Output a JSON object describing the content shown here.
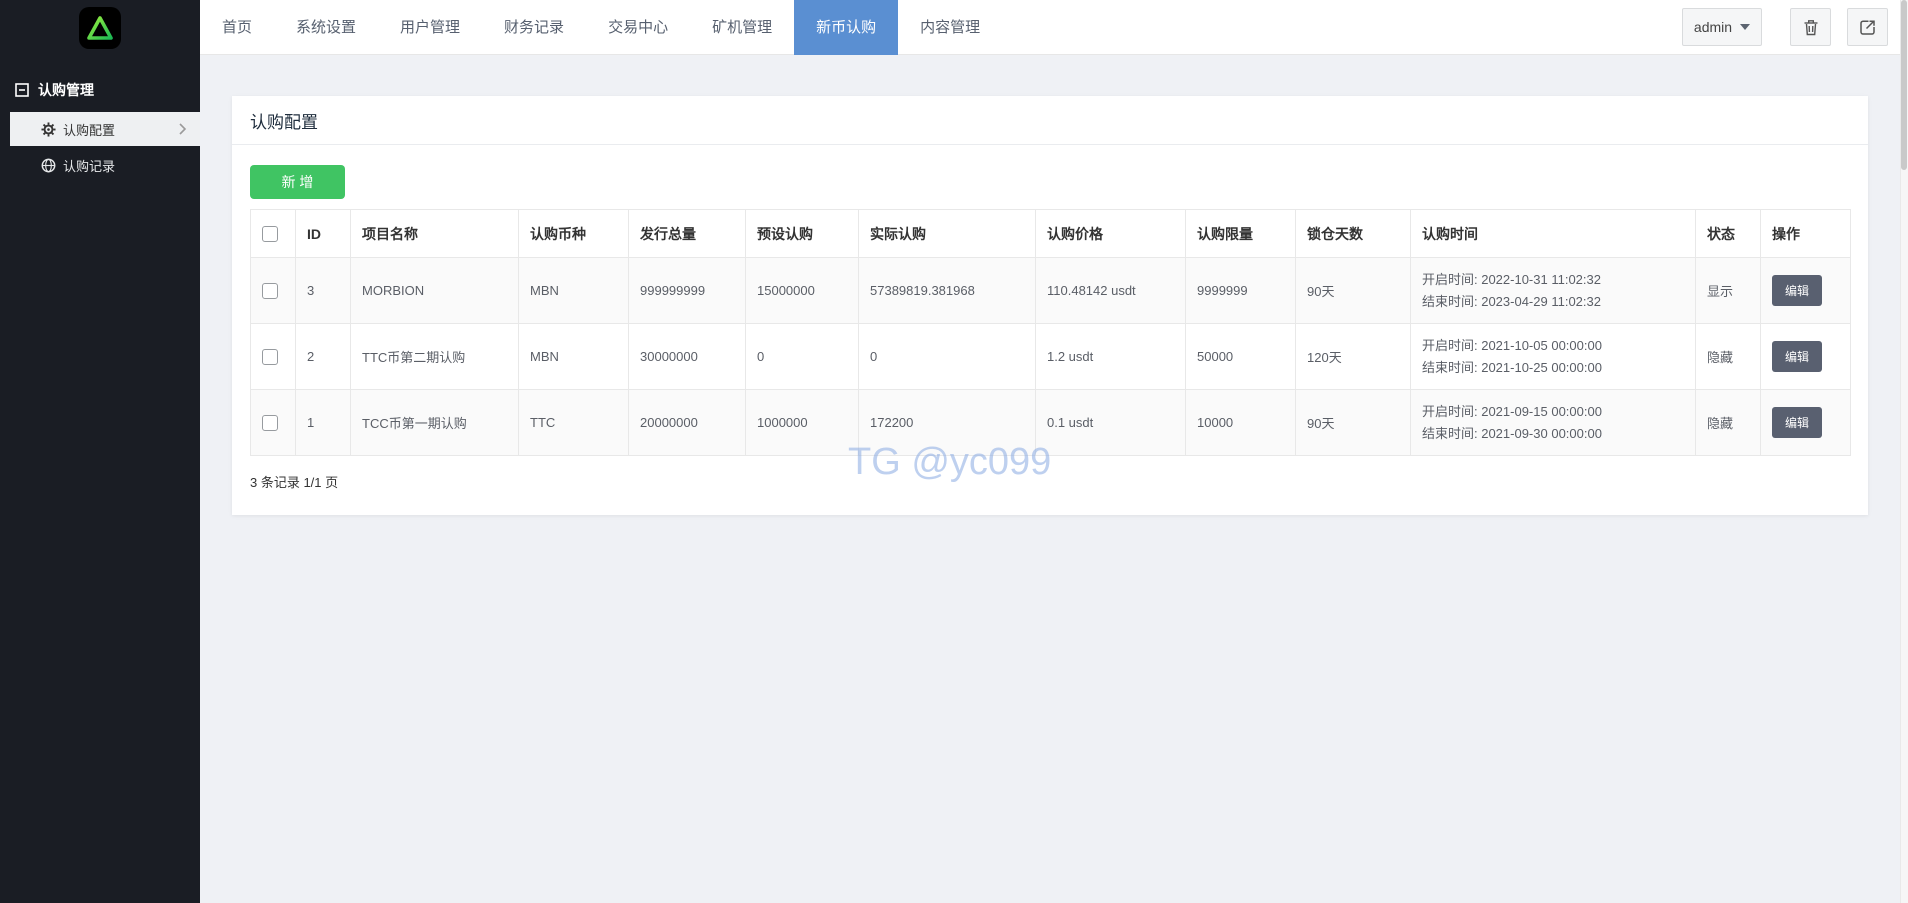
{
  "navbar": {
    "tabs": [
      {
        "label": "首页",
        "active": false
      },
      {
        "label": "系统设置",
        "active": false
      },
      {
        "label": "用户管理",
        "active": false
      },
      {
        "label": "财务记录",
        "active": false
      },
      {
        "label": "交易中心",
        "active": false
      },
      {
        "label": "矿机管理",
        "active": false
      },
      {
        "label": "新币认购",
        "active": true
      },
      {
        "label": "内容管理",
        "active": false
      }
    ],
    "user": {
      "name": "admin"
    },
    "icons": {
      "right_1": "trash-icon",
      "right_2": "logout-icon"
    }
  },
  "sidebar": {
    "section": {
      "label": "认购管理",
      "icon": "collapse-minus-icon"
    },
    "items": [
      {
        "label": "认购配置",
        "icon": "gear-icon",
        "active": true
      },
      {
        "label": "认购记录",
        "icon": "globe-icon",
        "active": false
      }
    ]
  },
  "page": {
    "title": "认购配置"
  },
  "toolbar": {
    "add_label": "新 增"
  },
  "table": {
    "headers": [
      "ID",
      "项目名称",
      "认购币种",
      "发行总量",
      "预设认购",
      "实际认购",
      "认购价格",
      "认购限量",
      "锁仓天数",
      "认购时间",
      "状态",
      "操作"
    ],
    "rows": [
      {
        "id": "3",
        "project": "MORBION",
        "coin": "MBN",
        "total": "999999999",
        "preset": "15000000",
        "actual": "57389819.381968",
        "price": "110.48142 usdt",
        "limit": "9999999",
        "lock": "90天",
        "time_start": "开启时间: 2022-10-31 11:02:32",
        "time_end": "结束时间: 2023-04-29 11:02:32",
        "status": "显示",
        "action": "编辑"
      },
      {
        "id": "2",
        "project": "TTC币第二期认购",
        "coin": "MBN",
        "total": "30000000",
        "preset": "0",
        "actual": "0",
        "price": "1.2 usdt",
        "limit": "50000",
        "lock": "120天",
        "time_start": "开启时间: 2021-10-05 00:00:00",
        "time_end": "结束时间: 2021-10-25 00:00:00",
        "status": "隐藏",
        "action": "编辑"
      },
      {
        "id": "1",
        "project": "TCC币第一期认购",
        "coin": "TTC",
        "total": "20000000",
        "preset": "1000000",
        "actual": "172200",
        "price": "0.1 usdt",
        "limit": "10000",
        "lock": "90天",
        "time_start": "开启时间: 2021-09-15 00:00:00",
        "time_end": "结束时间: 2021-09-30 00:00:00",
        "status": "隐藏",
        "action": "编辑"
      }
    ],
    "footer": "3 条记录 1/1 页"
  },
  "watermark": "TG @yc099",
  "colors": {
    "accent_blue": "#5a8fd2",
    "button_green": "#40c463",
    "edit_button": "#596070",
    "sidebar_bg": "#1a1d24",
    "watermark_blue": "#89aae2"
  }
}
